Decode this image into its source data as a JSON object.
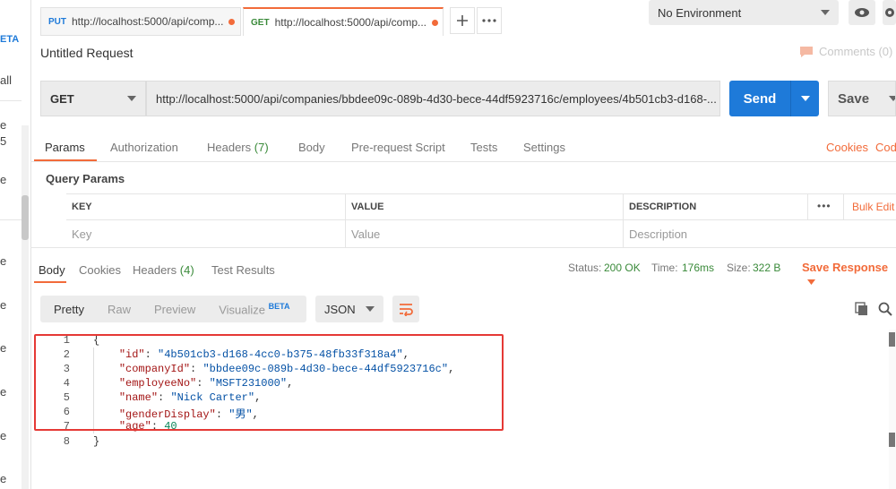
{
  "sidebar": {
    "fragments": [
      "ETA",
      "all",
      "e",
      "5",
      "e",
      "e",
      "e",
      "e",
      "e",
      "e",
      "e"
    ]
  },
  "tabs": [
    {
      "method": "PUT",
      "url": "http://localhost:5000/api/comp..."
    },
    {
      "method": "GET",
      "url": "http://localhost:5000/api/comp..."
    }
  ],
  "environment": {
    "selected": "No Environment"
  },
  "request": {
    "title": "Untitled Request",
    "comments": "Comments (0)",
    "method": "GET",
    "url": "http://localhost:5000/api/companies/bbdee09c-089b-4d30-bece-44df5923716c/employees/4b501cb3-d168-...",
    "send_label": "Send",
    "save_label": "Save",
    "tabs": {
      "params": "Params",
      "authorization": "Authorization",
      "headers": "Headers",
      "headers_count": "(7)",
      "body": "Body",
      "prerequest": "Pre-request Script",
      "tests": "Tests",
      "settings": "Settings",
      "cookies": "Cookies",
      "code": "Code"
    },
    "query_params": {
      "title": "Query Params",
      "columns": {
        "key": "KEY",
        "value": "VALUE",
        "description": "DESCRIPTION"
      },
      "placeholders": {
        "key": "Key",
        "value": "Value",
        "description": "Description"
      },
      "more": "•••",
      "bulk_edit": "Bulk Edit"
    }
  },
  "response": {
    "tabs": {
      "body": "Body",
      "cookies": "Cookies",
      "headers": "Headers",
      "headers_count": "(4)",
      "test_results": "Test Results"
    },
    "status_label": "Status:",
    "status_value": "200 OK",
    "time_label": "Time:",
    "time_value": "176ms",
    "size_label": "Size:",
    "size_value": "322 B",
    "save_response": "Save Response",
    "formats": {
      "pretty": "Pretty",
      "raw": "Raw",
      "preview": "Preview",
      "visualize": "Visualize",
      "beta": "BETA"
    },
    "language": "JSON",
    "body_lines": {
      "l1": "{",
      "l2_key": "\"id\"",
      "l2_val": "\"4b501cb3-d168-4cc0-b375-48fb33f318a4\"",
      "l3_key": "\"companyId\"",
      "l3_val": "\"bbdee09c-089b-4d30-bece-44df5923716c\"",
      "l4_key": "\"employeeNo\"",
      "l4_val": "\"MSFT231000\"",
      "l5_key": "\"name\"",
      "l5_val": "\"Nick Carter\"",
      "l6_key": "\"genderDisplay\"",
      "l6_val": "\"男\"",
      "l7_key": "\"age\"",
      "l7_val": "40",
      "l8": "}"
    },
    "line_numbers": [
      "1",
      "2",
      "3",
      "4",
      "5",
      "6",
      "7",
      "8"
    ]
  },
  "colors": {
    "accent": "#f26b3a",
    "send": "#1e7ad9",
    "highlight": "#e53935"
  }
}
